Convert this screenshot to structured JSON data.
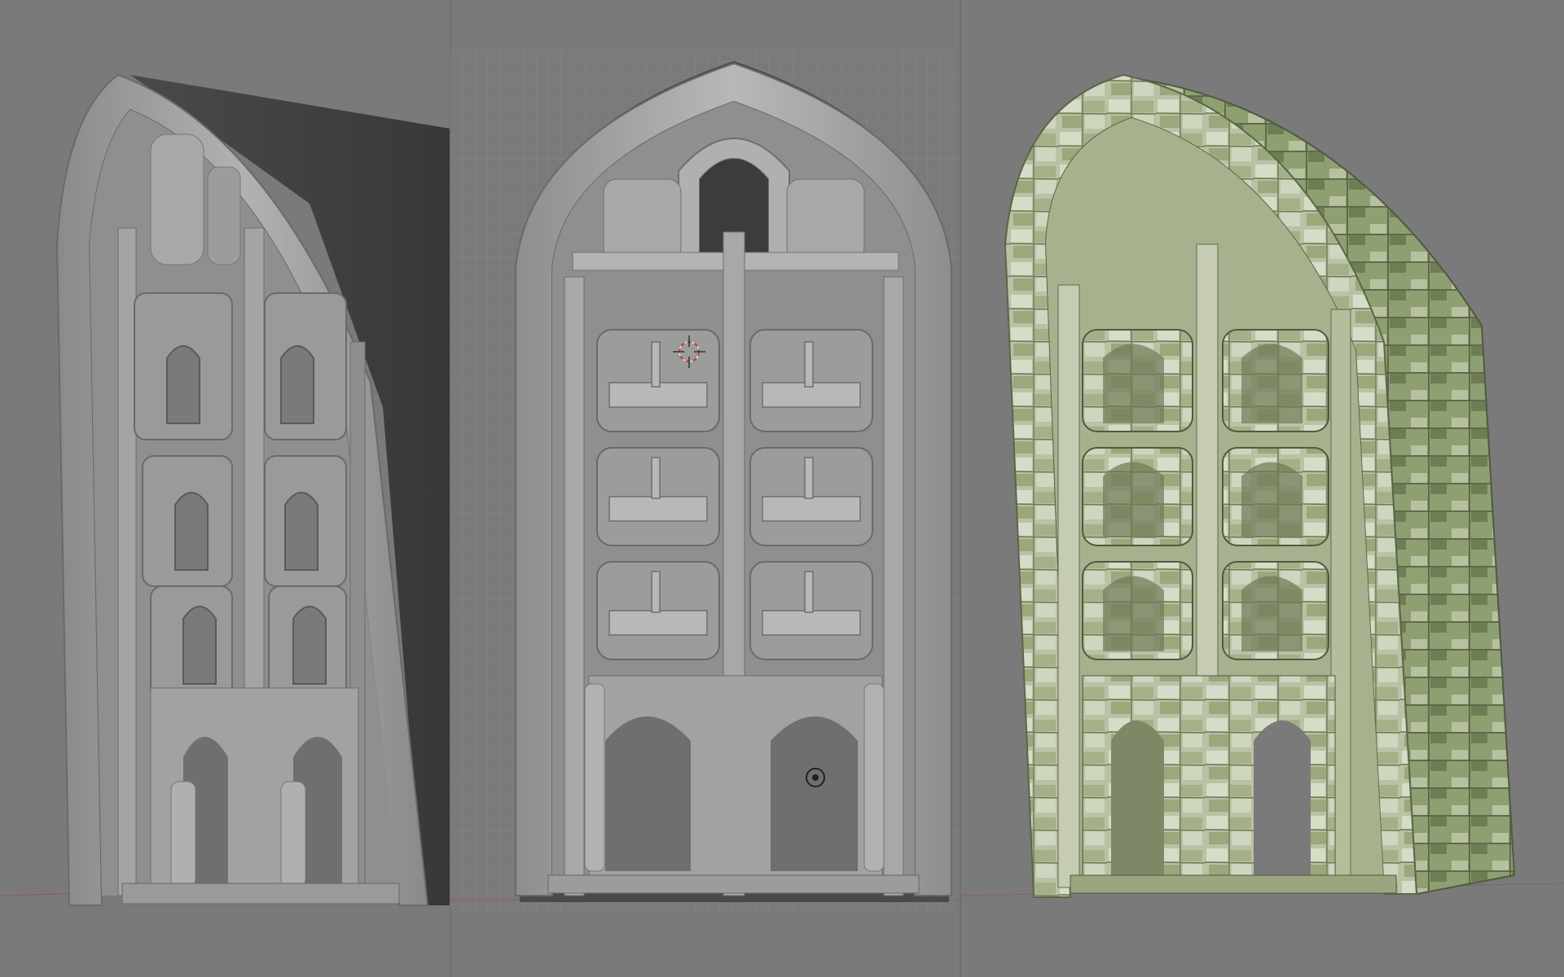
{
  "app": {
    "title": ""
  },
  "viewports": [
    {
      "id": "left",
      "shading": "solid",
      "model": "gothic-arch-module"
    },
    {
      "id": "center",
      "shading": "solid",
      "view": "orthographic-front",
      "grid": true,
      "model": "gothic-arch-module"
    },
    {
      "id": "right",
      "shading": "textured",
      "texture": "mossy-stone",
      "model": "gothic-arch-module"
    }
  ],
  "colors": {
    "viewport_bg": "#7a7a7a",
    "grid_line": "#868686",
    "mesh_light": "#bcbcbc",
    "mesh_mid": "#9e9e9e",
    "mesh_dark": "#5e5e5e",
    "mesh_shadow": "#3e3e3e",
    "stone_light": "#d6dcc8",
    "stone_moss": "#8e9f72",
    "stone_dark": "#4f5a40",
    "cursor_red": "#c33a30"
  }
}
